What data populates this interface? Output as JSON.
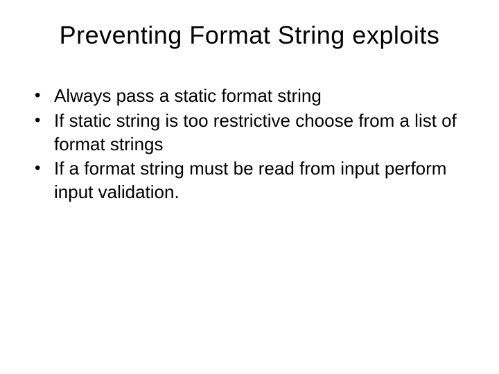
{
  "slide": {
    "title": "Preventing Format String exploits",
    "bullets": [
      "Always pass a static format string",
      "If static string is too restrictive choose from a list of format strings",
      "If a format string must be read from input perform input validation."
    ]
  }
}
